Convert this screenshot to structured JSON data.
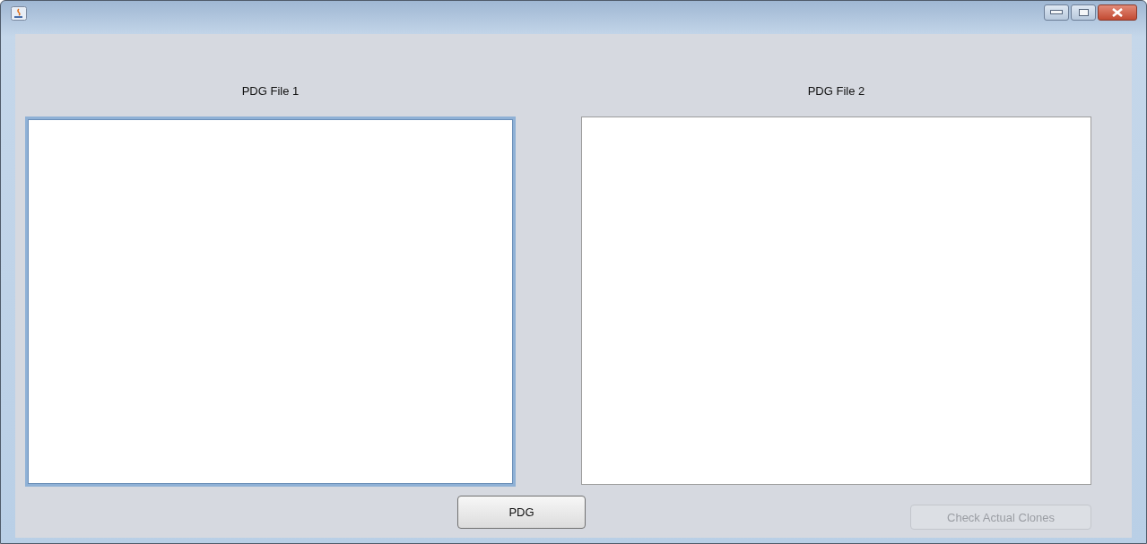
{
  "panels": [
    {
      "label": "PDG File 1",
      "focused": true
    },
    {
      "label": "PDG File 2",
      "focused": false
    }
  ],
  "buttons": [
    {
      "label": "PDG",
      "disabled": false
    },
    {
      "label": "Check Actual Clones",
      "disabled": true
    }
  ]
}
